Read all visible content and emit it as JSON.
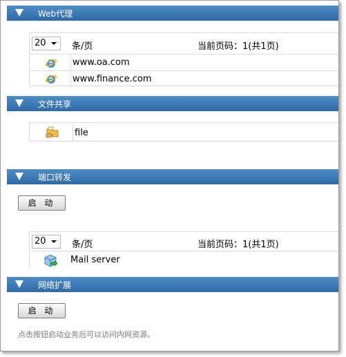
{
  "sections": {
    "web_proxy": {
      "title": "Web代理",
      "pager": {
        "page_size": "20",
        "per_page_label": "条/页",
        "page_info": "当前页码：1(共1页)"
      },
      "items": [
        {
          "icon": "ie-icon",
          "label": "www.oa.com"
        },
        {
          "icon": "ie-icon",
          "label": "www.finance.com"
        }
      ]
    },
    "file_share": {
      "title": "文件共享",
      "items": [
        {
          "icon": "folder-icon",
          "label": "file"
        }
      ]
    },
    "port_forward": {
      "title": "端口转发",
      "start_button": "启 动",
      "pager": {
        "page_size": "20",
        "per_page_label": "条/页",
        "page_info": "当前页码：1(共1页)"
      },
      "items": [
        {
          "icon": "server-icon",
          "label": "Mail server"
        }
      ]
    },
    "network_ext": {
      "title": "网络扩展",
      "start_button": "启 动",
      "hint": "点击按钮启动业务后可以访问内网资源。"
    }
  },
  "colors": {
    "header_top": "#4f8dc6",
    "header_bottom": "#2f6aa8",
    "border": "#dcdcdc",
    "hint_text": "#7a7a7a"
  }
}
